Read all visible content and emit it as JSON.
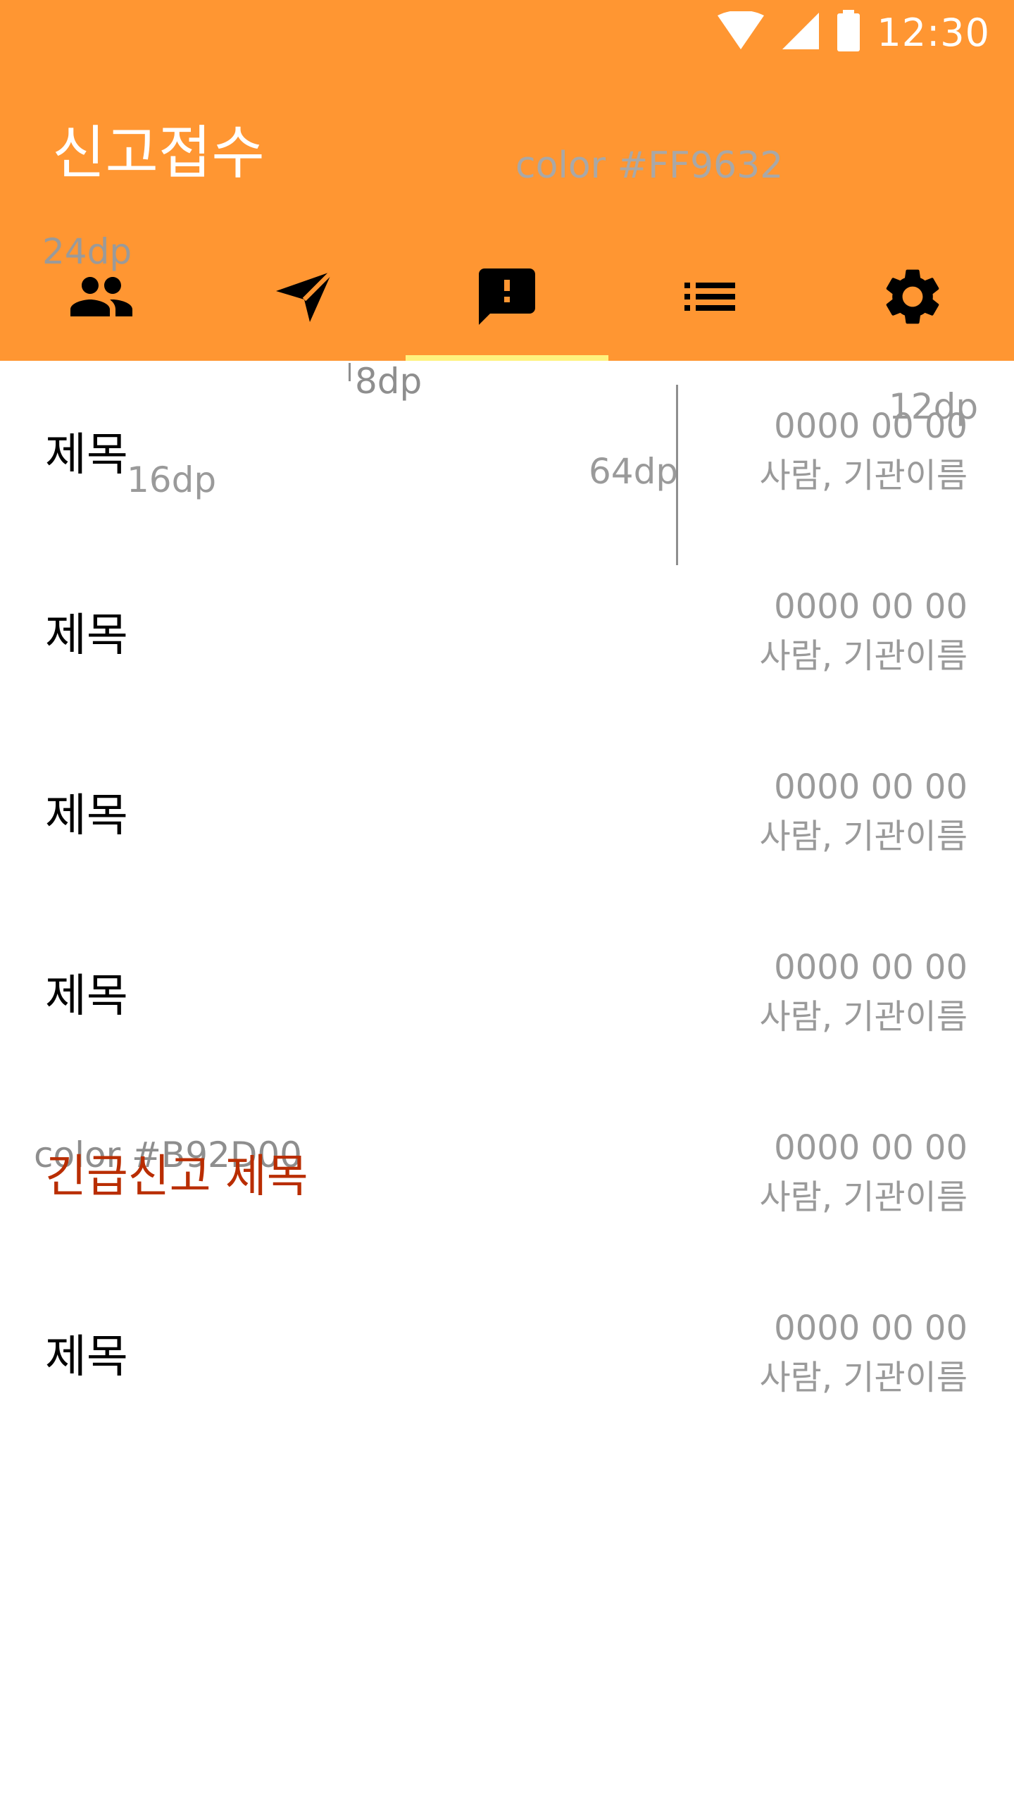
{
  "theme": {
    "appbar_color": "#FF9632",
    "urgent_color": "#B92D00",
    "indicator_color": "#FFF27E"
  },
  "status_bar": {
    "time": "12:30",
    "icons": [
      "wifi-icon",
      "signal-icon",
      "battery-icon"
    ]
  },
  "app_bar": {
    "title": "신고접수"
  },
  "tabs": [
    {
      "icon": "people-icon",
      "selected": false
    },
    {
      "icon": "send-icon",
      "selected": false
    },
    {
      "icon": "report-icon",
      "selected": true
    },
    {
      "icon": "list-icon",
      "selected": false
    },
    {
      "icon": "settings-icon",
      "selected": false
    }
  ],
  "annotations": {
    "appbar_color": "color #FF9632",
    "icon_size": "24dp",
    "indicator_gap": "8dp",
    "top_padding": "12dp",
    "left_padding": "16dp",
    "meta_width": "64dp",
    "urgent_color": "color #B92D00"
  },
  "reports": [
    {
      "title": "제목",
      "date": "0000 00 00",
      "org": "사람, 기관이름",
      "urgent": false
    },
    {
      "title": "제목",
      "date": "0000 00 00",
      "org": "사람, 기관이름",
      "urgent": false
    },
    {
      "title": "제목",
      "date": "0000 00 00",
      "org": "사람, 기관이름",
      "urgent": false
    },
    {
      "title": "제목",
      "date": "0000 00 00",
      "org": "사람, 기관이름",
      "urgent": false
    },
    {
      "title": "긴급신고 제목",
      "date": "0000 00 00",
      "org": "사람, 기관이름",
      "urgent": true
    },
    {
      "title": "제목",
      "date": "0000 00 00",
      "org": "사람, 기관이름",
      "urgent": false
    }
  ]
}
